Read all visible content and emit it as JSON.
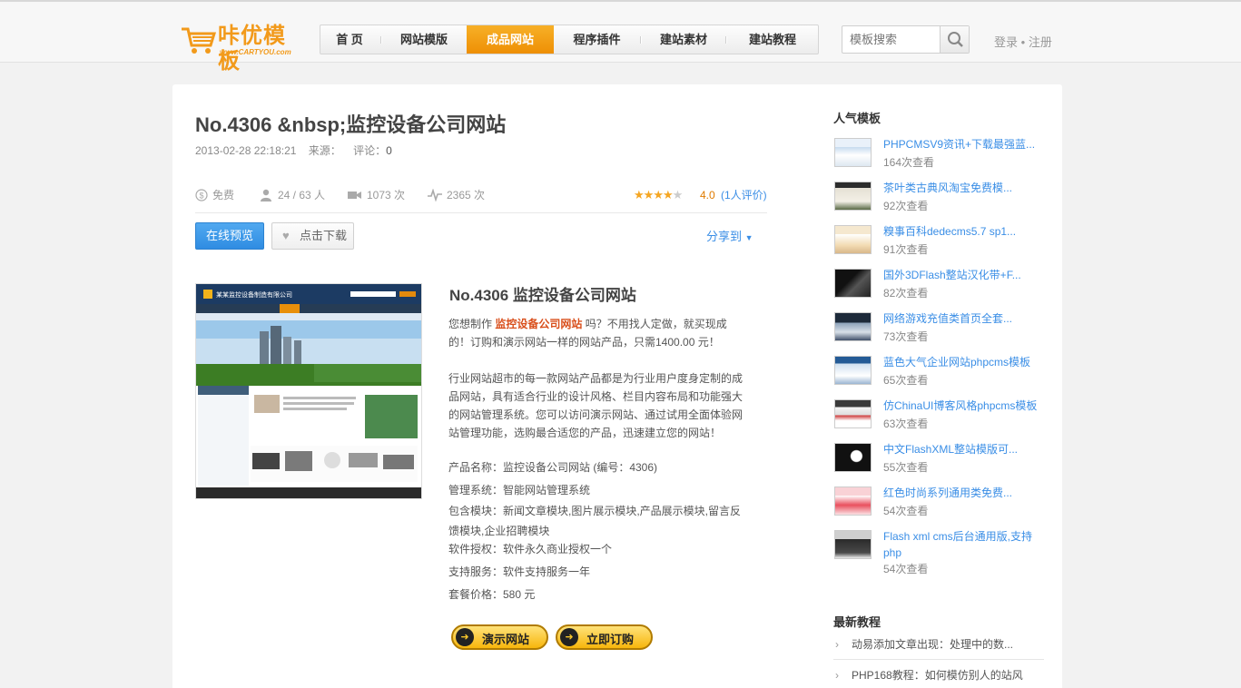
{
  "logo": {
    "name": "咔优模板",
    "sub": "www.CARTYOU.com"
  },
  "nav": [
    {
      "label": "首 页"
    },
    {
      "label": "网站模版"
    },
    {
      "label": "成品网站"
    },
    {
      "label": "程序插件"
    },
    {
      "label": "建站素材"
    },
    {
      "label": "建站教程"
    }
  ],
  "search": {
    "placeholder": "模板搜索"
  },
  "user": {
    "login": "登录",
    "sep": "•",
    "register": "注册"
  },
  "article": {
    "title": "No.4306 &nbsp;监控设备公司网站",
    "date": "2013-02-28 22:18:21",
    "source_label": "来源：",
    "comment_label": "评论：",
    "comment_count": "0",
    "price": "免费",
    "users": "24 / 63 人",
    "videos": "1073 次",
    "views": "2365 次",
    "rating": 4.0,
    "score": "4.0",
    "rate_count": "(1人评价)",
    "preview_label": "在线预览",
    "download_label": "点击下载",
    "share_label": "分享到"
  },
  "product": {
    "title": "No.4306  监控设备公司网站",
    "intro_pre": "您想制作",
    "intro_hl": "监控设备公司网站",
    "intro_post": "吗？不用找人定做，就买现成的！订购和演示网站一样的网站产品，只需1400.00 元！",
    "desc": "行业网站超市的每一款网站产品都是为行业用户度身定制的成品网站，具有适合行业的设计风格、栏目内容布局和功能强大的网站管理系统。您可以访问演示网站、通过试用全面体验网站管理功能，选购最合适您的产品，迅速建立您的网站！",
    "spec_name": "产品名称：监控设备公司网站 (编号：4306)",
    "spec_system": "管理系统：智能网站管理系统",
    "spec_modules": "包含模块：新闻文章模块,图片展示模块,产品展示模块,留言反馈模块,企业招聘模块",
    "spec_license": "软件授权：软件永久商业授权一个",
    "spec_service": "支持服务：软件支持服务一年",
    "spec_price": "套餐价格：580 元",
    "demo_btn": "演示网站",
    "order_btn": "立即订购",
    "thumb_company": "某某监控设备制造有限公司"
  },
  "sidebar": {
    "popular_title": "人气模板",
    "popular": [
      {
        "title": "PHPCMSV9资讯+下载最强蓝...",
        "views": "164次查看"
      },
      {
        "title": "茶叶类古典风淘宝免费模...",
        "views": "92次查看"
      },
      {
        "title": "糗事百科dedecms5.7 sp1...",
        "views": "91次查看"
      },
      {
        "title": "国外3DFlash整站汉化带+F...",
        "views": "82次查看"
      },
      {
        "title": "网络游戏充值类首页全套...",
        "views": "73次查看"
      },
      {
        "title": "蓝色大气企业网站phpcms模板",
        "views": "65次查看"
      },
      {
        "title": "仿ChinaUI博客风格phpcms模板",
        "views": "63次查看"
      },
      {
        "title": "中文FlashXML整站模版可...",
        "views": "55次查看"
      },
      {
        "title": "红色时尚系列通用类免费...",
        "views": "54次查看"
      },
      {
        "title": "Flash xml cms后台通用版,支持php",
        "views": "54次查看"
      }
    ],
    "tutorials_title": "最新教程",
    "tutorials": [
      {
        "title": "动易添加文章出现：处理中的数..."
      },
      {
        "title": "PHP168教程：如何模仿别人的站风"
      }
    ]
  },
  "colors": {
    "accent": "#f29a1b",
    "link": "#3a8ee6",
    "nav_active": "#ee8f05",
    "highlight": "#d94f1c"
  }
}
